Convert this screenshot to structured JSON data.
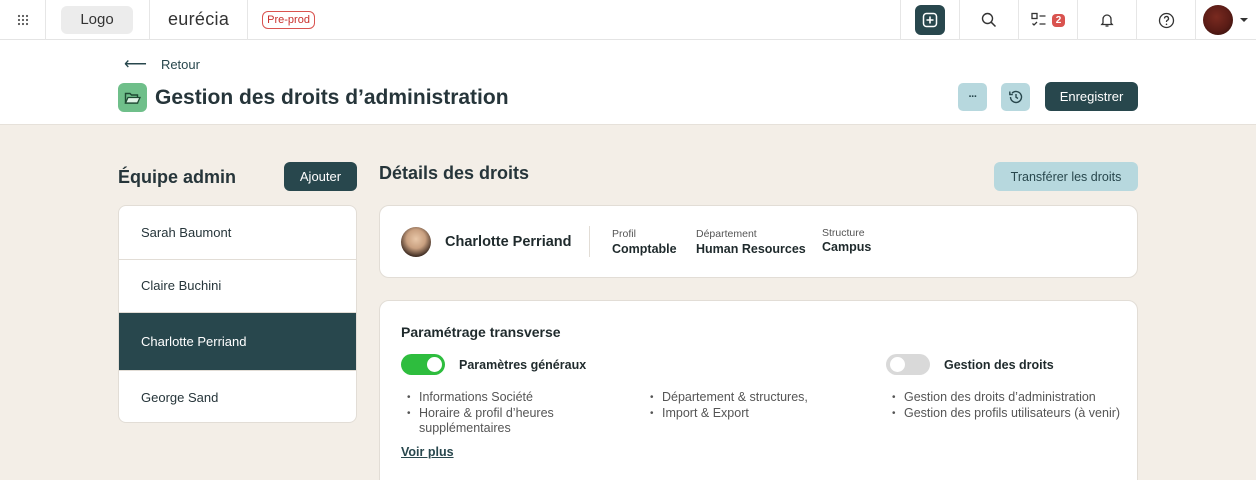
{
  "topbar": {
    "logo": "Logo",
    "brand": "eurécia",
    "env_badge": "Pre-prod",
    "tasks_count": "2"
  },
  "header": {
    "back_label": "Retour",
    "title": "Gestion des droits d’administration",
    "more_label": "···",
    "save_label": "Enregistrer"
  },
  "team": {
    "title": "Équipe admin",
    "add_label": "Ajouter",
    "members": [
      "Sarah Baumont",
      "Claire Buchini",
      "Charlotte Perriand",
      "George Sand"
    ],
    "selected": "Charlotte Perriand"
  },
  "details": {
    "title": "Détails des droits",
    "transfer_label": "Transférer les droits",
    "person": {
      "name": "Charlotte Perriand",
      "profile_label": "Profil",
      "profile_value": "Comptable",
      "department_label": "Département",
      "department_value": "Human Resources",
      "structure_label": "Structure",
      "structure_value": "Campus"
    },
    "section_title": "Paramétrage transverse",
    "general": {
      "label": "Paramètres généraux",
      "enabled": true,
      "col1": [
        "Informations Société",
        "Horaire & profil d’heures supplémentaires"
      ],
      "col2": [
        "Département & structures,",
        "Import & Export"
      ]
    },
    "rights": {
      "label": "Gestion des droits",
      "enabled": false,
      "items": [
        "Gestion des droits d’administration",
        "Gestion des profils utilisateurs (à venir)"
      ]
    },
    "more_link": "Voir plus"
  },
  "colors": {
    "primary": "#28474d",
    "accent_light": "#b7d8de",
    "toggle_on": "#2ebd3e",
    "background": "#f3eee7",
    "alert": "#d9534f"
  }
}
